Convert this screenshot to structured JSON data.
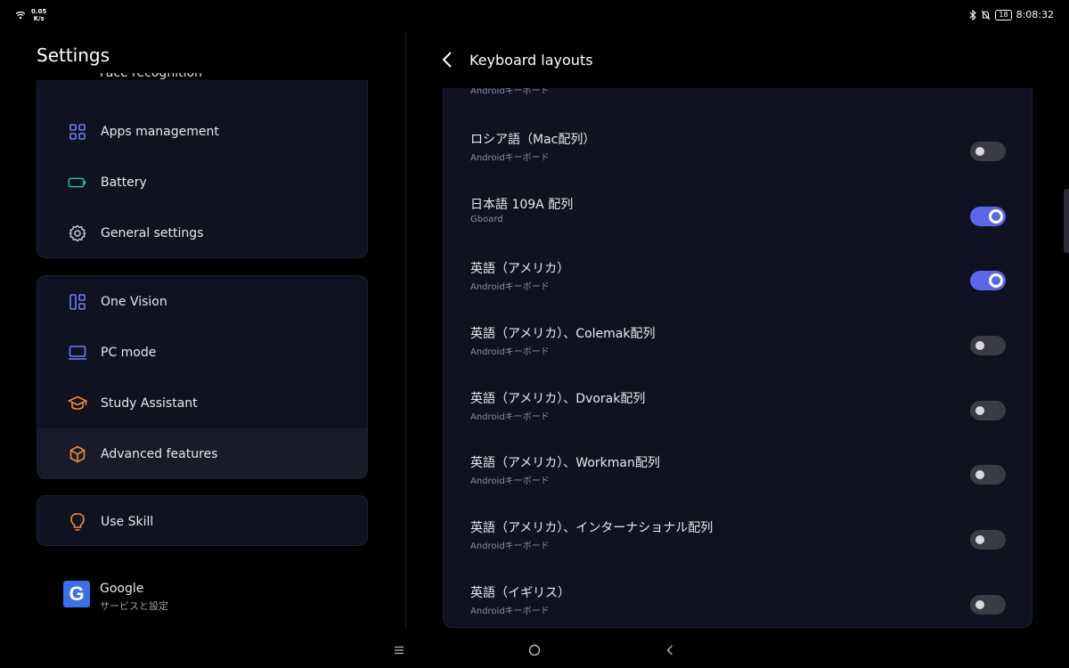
{
  "status_bar": {
    "net_speed_value": "0.05",
    "net_speed_unit": "K/s",
    "battery": "18",
    "time": "8:08:32"
  },
  "left": {
    "title": "Settings",
    "partial_item": "Face recognition",
    "card1": [
      {
        "label": "Apps management",
        "icon": "apps-grid-icon"
      },
      {
        "label": "Battery",
        "icon": "battery-icon"
      },
      {
        "label": "General settings",
        "icon": "gear-icon"
      }
    ],
    "card2": [
      {
        "label": "One Vision",
        "icon": "one-vision-icon"
      },
      {
        "label": "PC mode",
        "icon": "laptop-icon"
      },
      {
        "label": "Study Assistant",
        "icon": "graduation-cap-icon"
      },
      {
        "label": "Advanced features",
        "icon": "hexagon-icon"
      }
    ],
    "card3": [
      {
        "label": "Use Skill",
        "icon": "lightbulb-icon"
      }
    ],
    "google": {
      "title": "Google",
      "subtitle": "サービスと設定",
      "logo_letter": "G"
    }
  },
  "right": {
    "title": "Keyboard layouts",
    "partial_subtitle": "Androidキーボード",
    "rows": [
      {
        "title": "ロシア語（Mac配列）",
        "subtitle": "Androidキーボード",
        "enabled": false
      },
      {
        "title": "日本語 109A 配列",
        "subtitle": "Gboard",
        "enabled": true
      },
      {
        "title": "英語（アメリカ）",
        "subtitle": "Androidキーボード",
        "enabled": true
      },
      {
        "title": "英語（アメリカ）、Colemak配列",
        "subtitle": "Androidキーボード",
        "enabled": false
      },
      {
        "title": "英語（アメリカ）、Dvorak配列",
        "subtitle": "Androidキーボード",
        "enabled": false
      },
      {
        "title": "英語（アメリカ）、Workman配列",
        "subtitle": "Androidキーボード",
        "enabled": false
      },
      {
        "title": "英語（アメリカ）、インターナショナル配列",
        "subtitle": "Androidキーボード",
        "enabled": false
      },
      {
        "title": "英語（イギリス）",
        "subtitle": "Androidキーボード",
        "enabled": false
      }
    ]
  },
  "colors": {
    "accent": "#5a67e8",
    "background": "#000000",
    "card": "#101221"
  }
}
